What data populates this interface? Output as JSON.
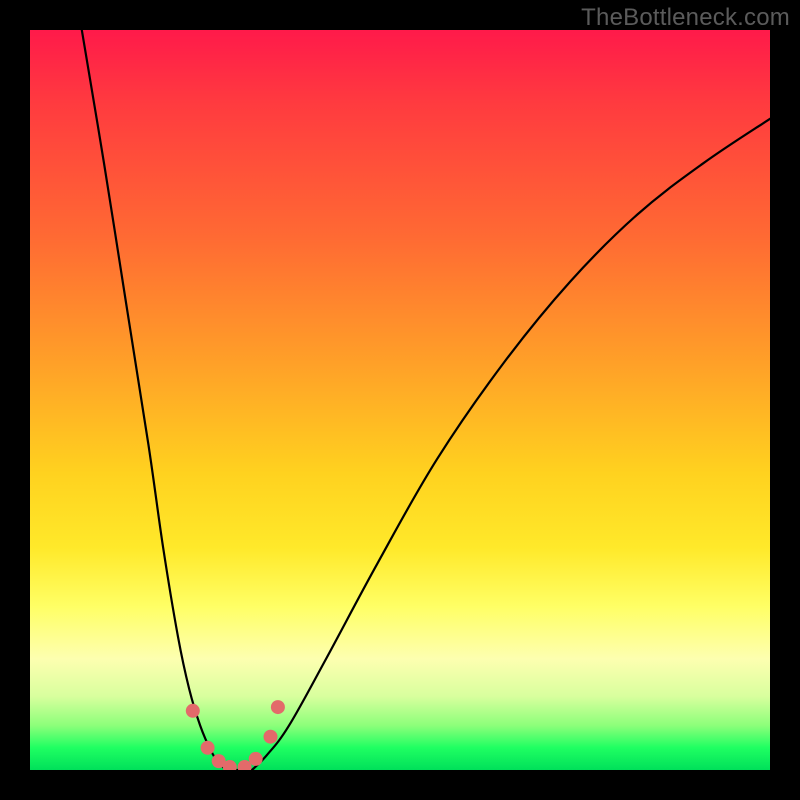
{
  "watermark": "TheBottleneck.com",
  "chart_data": {
    "type": "line",
    "title": "",
    "xlabel": "",
    "ylabel": "",
    "xlim": [
      0,
      100
    ],
    "ylim": [
      0,
      100
    ],
    "grid": false,
    "series": [
      {
        "name": "bottleneck-curve-left",
        "x": [
          7,
          10,
          13,
          16,
          18,
          20,
          21.5,
          23,
          24.5,
          25.5,
          26.5
        ],
        "y": [
          100,
          82,
          63,
          44,
          30,
          18,
          11,
          6,
          2.5,
          1,
          0
        ]
      },
      {
        "name": "bottleneck-curve-right",
        "x": [
          30,
          32,
          35,
          40,
          47,
          55,
          64,
          73,
          82,
          91,
          100
        ],
        "y": [
          0,
          2,
          6,
          15,
          28,
          42,
          55,
          66,
          75,
          82,
          88
        ]
      }
    ],
    "floor": {
      "name": "curve-floor",
      "x": [
        26.5,
        30
      ],
      "y": [
        0,
        0
      ]
    },
    "markers": [
      {
        "x": 22.0,
        "y": 8.0,
        "r": 1.2
      },
      {
        "x": 24.0,
        "y": 3.0,
        "r": 1.1
      },
      {
        "x": 25.5,
        "y": 1.2,
        "r": 1.1
      },
      {
        "x": 27.0,
        "y": 0.4,
        "r": 1.1
      },
      {
        "x": 29.0,
        "y": 0.4,
        "r": 1.1
      },
      {
        "x": 30.5,
        "y": 1.5,
        "r": 1.1
      },
      {
        "x": 32.5,
        "y": 4.5,
        "r": 1.1
      },
      {
        "x": 33.5,
        "y": 8.5,
        "r": 1.2
      }
    ],
    "gradient_stops": [
      {
        "pos": 0,
        "color": "#ff1a4a"
      },
      {
        "pos": 10,
        "color": "#ff3b3f"
      },
      {
        "pos": 28,
        "color": "#ff6a33"
      },
      {
        "pos": 45,
        "color": "#ffa028"
      },
      {
        "pos": 60,
        "color": "#ffd21f"
      },
      {
        "pos": 70,
        "color": "#ffe92a"
      },
      {
        "pos": 78,
        "color": "#ffff66"
      },
      {
        "pos": 85,
        "color": "#fdffb0"
      },
      {
        "pos": 90,
        "color": "#d9ff9e"
      },
      {
        "pos": 94,
        "color": "#8cff7a"
      },
      {
        "pos": 97,
        "color": "#1fff62"
      },
      {
        "pos": 100,
        "color": "#00e05a"
      }
    ]
  }
}
